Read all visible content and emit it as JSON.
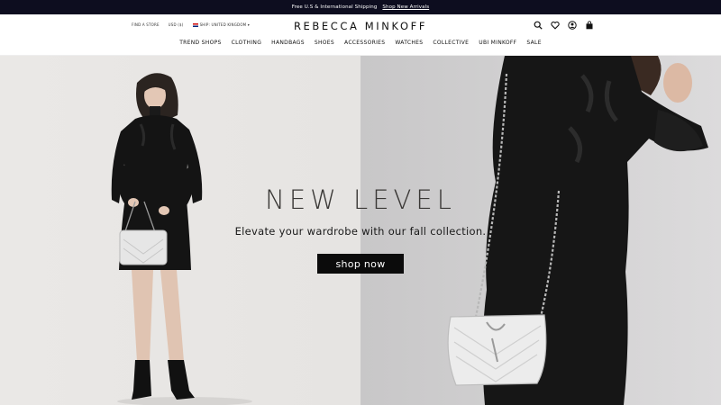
{
  "promo": {
    "text": "Free U.S & International Shipping",
    "link": "Shop New Arrivals"
  },
  "header": {
    "utility": {
      "find_store": "Find a Store",
      "currency": "USD ($)",
      "region": "Ship: United Kingdom"
    },
    "logo": "REBECCA MINKOFF",
    "icons": [
      "search-icon",
      "heart-icon",
      "account-icon",
      "bag-icon"
    ],
    "nav": [
      "TREND SHOPS",
      "CLOTHING",
      "HANDBAGS",
      "SHOES",
      "ACCESSORIES",
      "WATCHES",
      "COLLECTIVE",
      "UBI MINKOFF",
      "SALE"
    ]
  },
  "hero": {
    "headline": "NEW LEVEL",
    "subline": "Elevate your wardrobe with our fall collection.",
    "cta": "shop now"
  },
  "colors": {
    "promo_bg": "#0d0d1f",
    "cta_bg": "#0b0b0b",
    "hero_left_bg": "#e8e6e4",
    "hero_right_bg": "#cfcecf"
  }
}
